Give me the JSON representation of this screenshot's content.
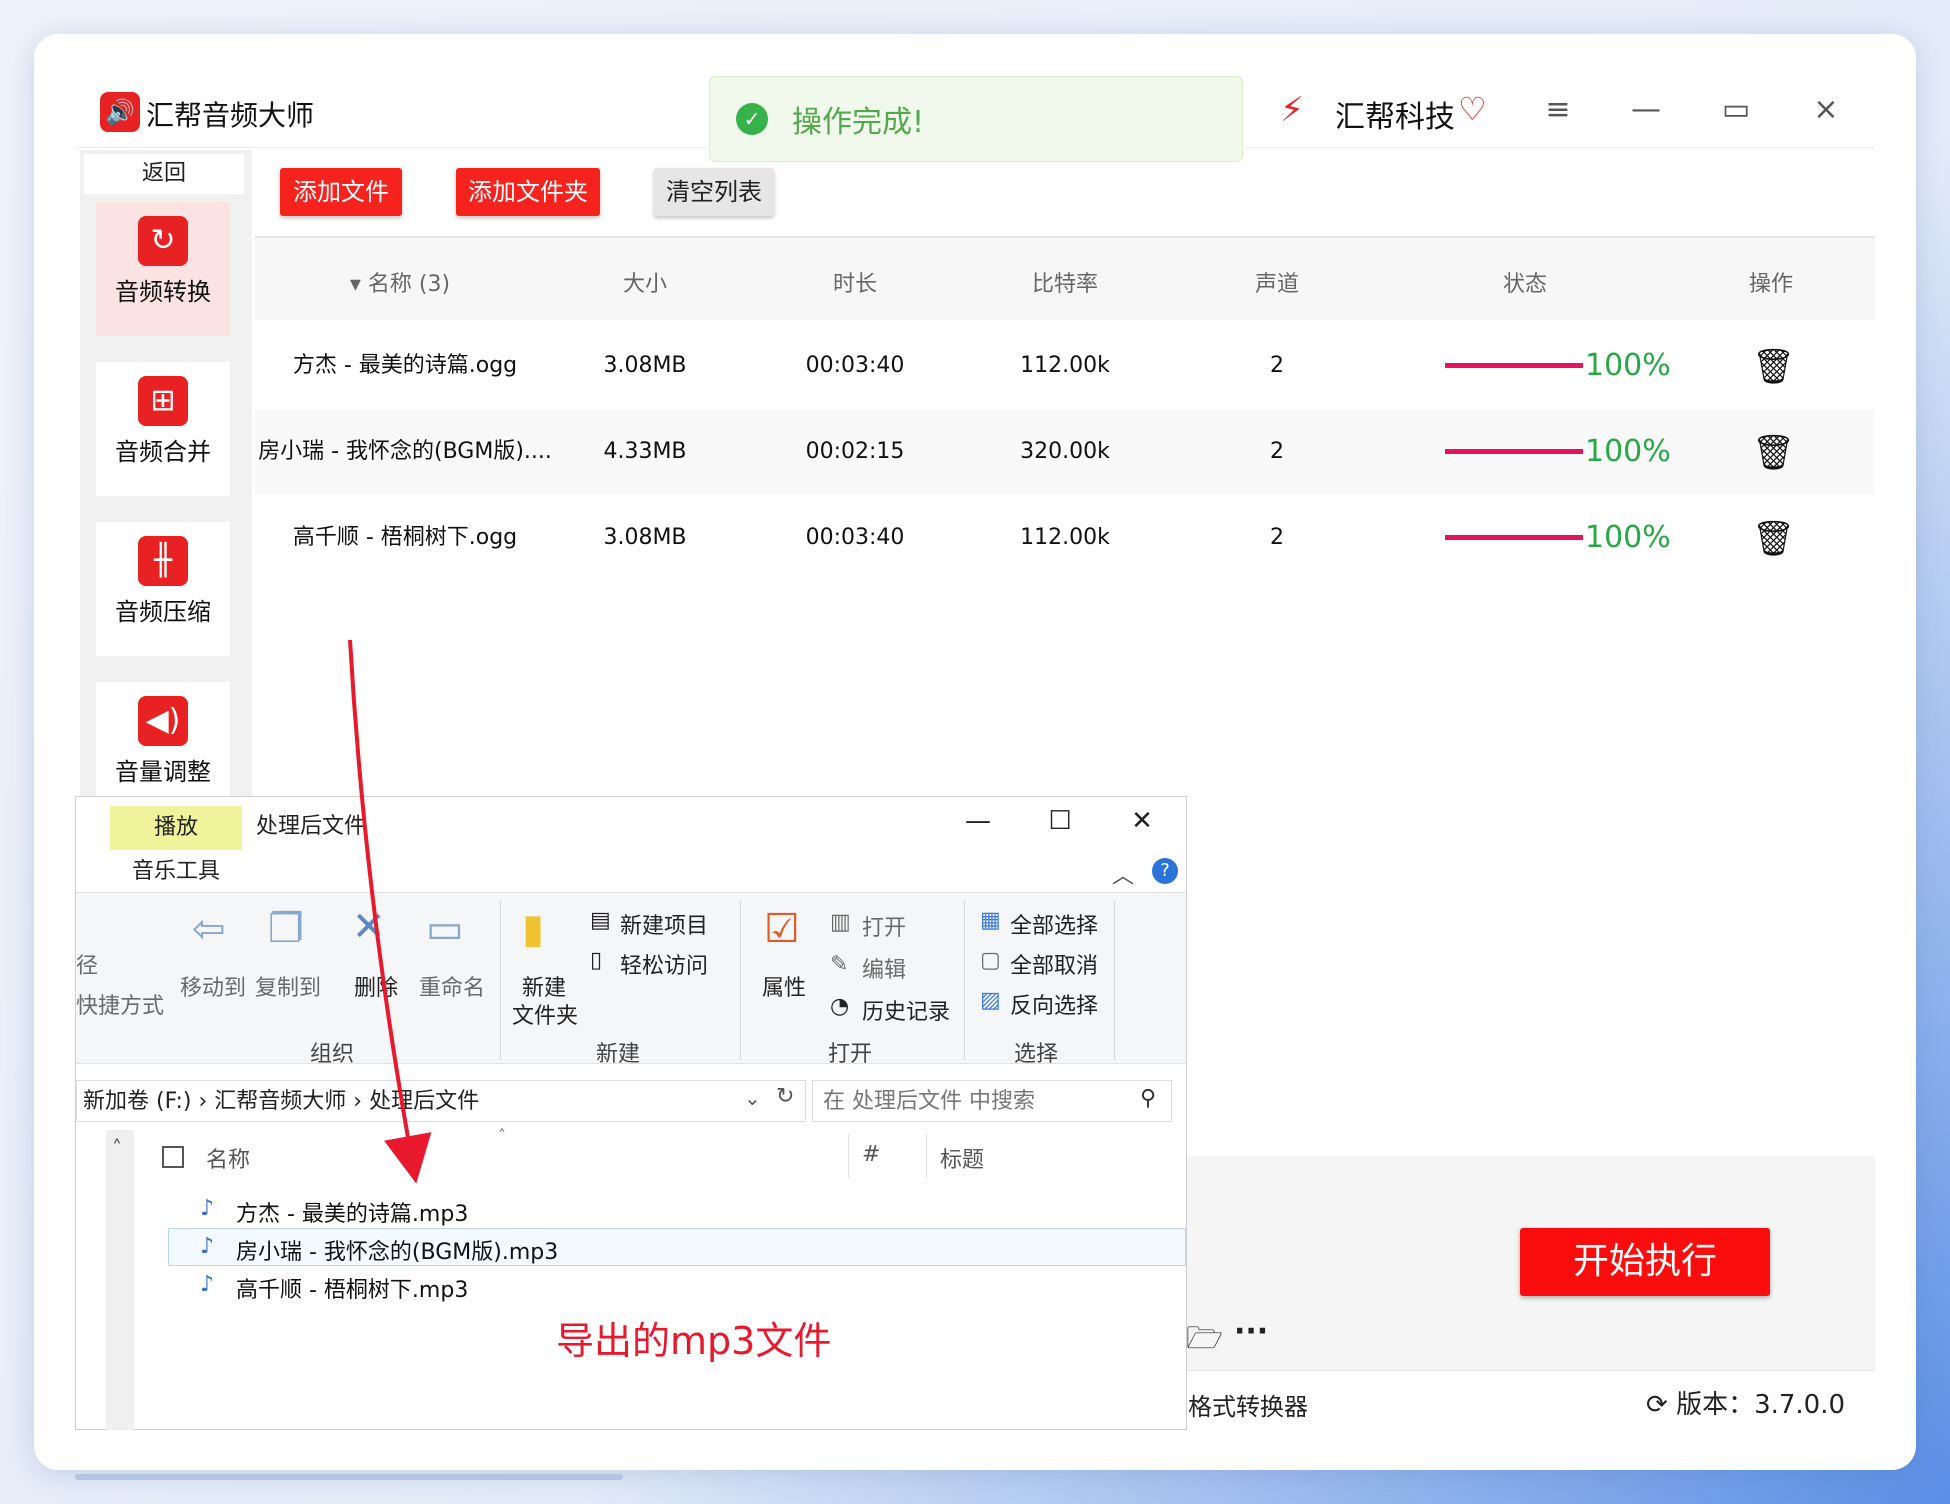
{
  "app": {
    "title": "汇帮音频大师",
    "logo_icon": "speaker-icon"
  },
  "toast": {
    "text": "操作完成!",
    "icon": "check-circle-icon"
  },
  "brand": {
    "name": "汇帮科技",
    "vip_icon": "heart-gem-icon"
  },
  "window_controls": {
    "menu": "≡",
    "minimize": "—",
    "maximize": "▭",
    "close": "×"
  },
  "sidebar": {
    "back": "返回",
    "items": [
      {
        "label": "音频转换",
        "icon": "↻",
        "active": true
      },
      {
        "label": "音频合并",
        "icon": "⊞"
      },
      {
        "label": "音频压缩",
        "icon": "╫"
      },
      {
        "label": "音量调整",
        "icon": "◀)"
      }
    ]
  },
  "toolbar": {
    "add_file": "添加文件",
    "add_folder": "添加文件夹",
    "clear_list": "清空列表"
  },
  "table": {
    "headers": {
      "name": "▾ 名称 (3)",
      "size": "大小",
      "duration": "时长",
      "bitrate": "比特率",
      "channels": "声道",
      "status": "状态",
      "action": "操作"
    },
    "rows": [
      {
        "name": "方杰 - 最美的诗篇.ogg",
        "size": "3.08MB",
        "duration": "00:03:40",
        "bitrate": "112.00k",
        "channels": "2",
        "progress": 1.0,
        "progress_text": "100%"
      },
      {
        "name": "房小瑞 - 我怀念的(BGM版)....",
        "size": "4.33MB",
        "duration": "00:02:15",
        "bitrate": "320.00k",
        "channels": "2",
        "progress": 1.0,
        "progress_text": "100%"
      },
      {
        "name": "高千顺 - 梧桐树下.ogg",
        "size": "3.08MB",
        "duration": "00:03:40",
        "bitrate": "112.00k",
        "channels": "2",
        "progress": 1.0,
        "progress_text": "100%"
      }
    ]
  },
  "start_button": "开始执行",
  "footer": {
    "text": "格式转换器",
    "version": "版本：3.7.0.0"
  },
  "explorer": {
    "title": "处理后文件",
    "tab_play": "播放",
    "tab_music": "音乐工具",
    "ribbon": {
      "path_cut": "径",
      "shortcut_cut": "快捷方式",
      "move_to": "移动到",
      "copy_to": "复制到",
      "delete": "删除",
      "rename": "重命名",
      "group_organize": "组织",
      "new_folder_1": "新建",
      "new_folder_2": "文件夹",
      "new_item": "新建项目",
      "easy_access": "轻松访问",
      "group_new": "新建",
      "properties": "属性",
      "open": "打开",
      "edit": "编辑",
      "history": "历史记录",
      "group_open": "打开",
      "select_all": "全部选择",
      "select_none": "全部取消",
      "invert_select": "反向选择",
      "group_select": "选择"
    },
    "address": "新加卷 (F:)  ›  汇帮音频大师  ›  处理后文件",
    "search_placeholder": "在 处理后文件 中搜索",
    "columns": {
      "name": "名称",
      "number": "#",
      "title": "标题"
    },
    "files": [
      "方杰 - 最美的诗篇.mp3",
      "房小瑞 - 我怀念的(BGM版).mp3",
      "高千顺 - 梧桐树下.mp3"
    ]
  },
  "annotation": "导出的mp3文件",
  "colors": {
    "accent_red": "#f5221e",
    "progress": "#e8115e",
    "success": "#28a745"
  }
}
